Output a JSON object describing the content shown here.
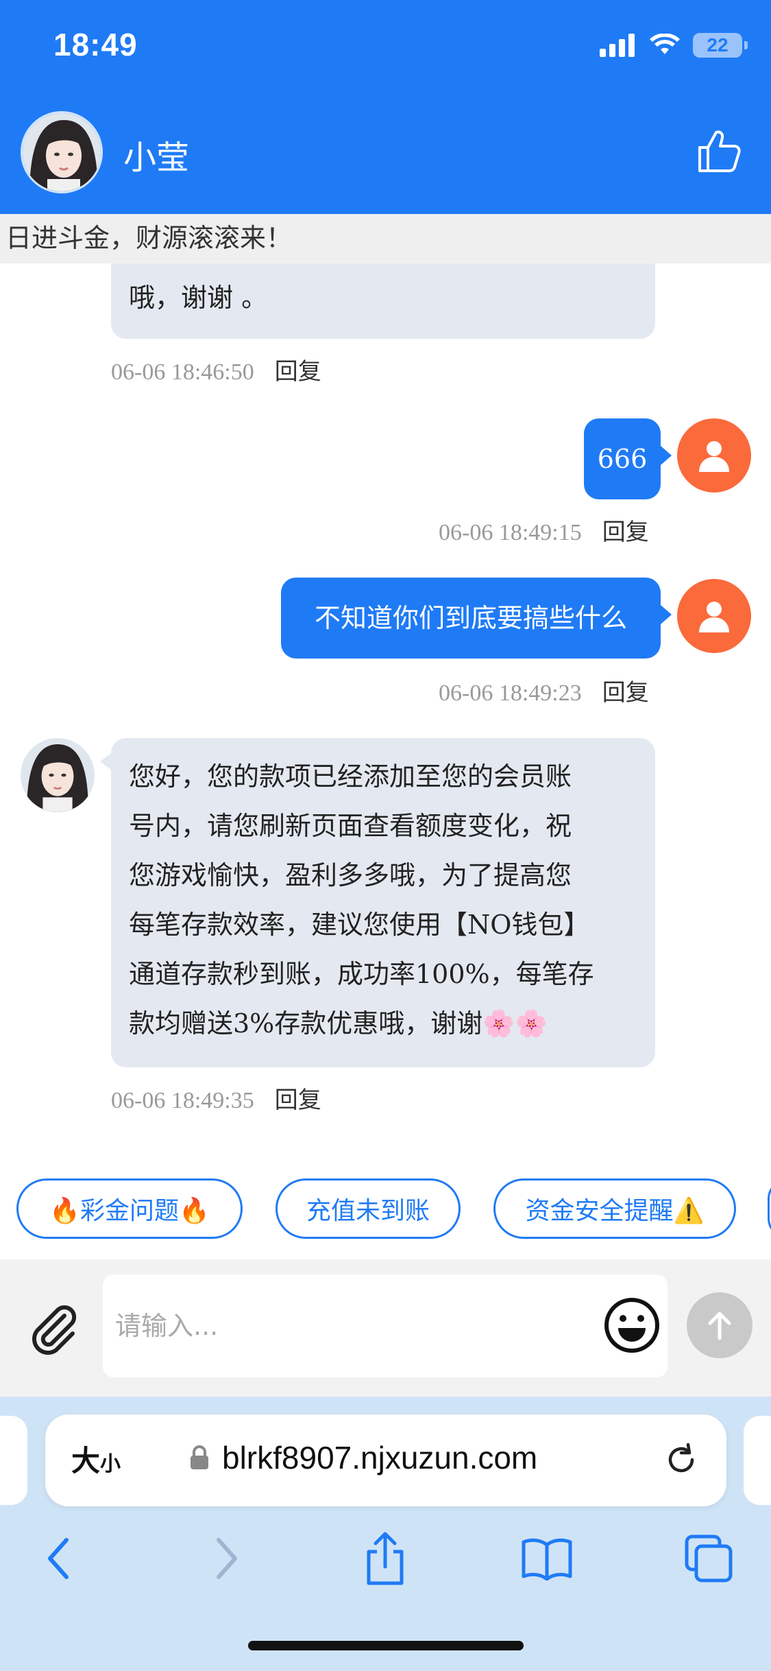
{
  "status_bar": {
    "time": "18:49",
    "battery": "22"
  },
  "header": {
    "agent_name": "小莹"
  },
  "marquee": "日进斗金，财源滚滚来！",
  "messages": [
    {
      "side": "in",
      "text": "哦，谢谢 。",
      "time": "06-06 18:46:50",
      "reply": "回复"
    },
    {
      "side": "out",
      "text": "666",
      "time": "06-06 18:49:15",
      "reply": "回复"
    },
    {
      "side": "out",
      "text": "不知道你们到底要搞些什么",
      "time": "06-06 18:49:23",
      "reply": "回复"
    },
    {
      "side": "in",
      "lines": [
        "您好，您的款项已经添加至您的会员账",
        "号内，请您刷新页面查看额度变化，祝",
        "您游戏愉快，盈利多多哦，为了提高您",
        "每笔存款效率，建议您使用【NO钱包】",
        "通道存款秒到账，成功率100%，每笔存",
        "款均赠送3%存款优惠哦，谢谢🌸🌸"
      ],
      "time": "06-06 18:49:35",
      "reply": "回复"
    }
  ],
  "quick_replies": [
    "🔥彩金问题🔥",
    "充值未到账",
    "资金安全提醒⚠️"
  ],
  "input": {
    "placeholder": "请输入..."
  },
  "browser": {
    "text_size_big": "大",
    "text_size_small": "小",
    "url": "blrkf8907.njxuzun.com"
  },
  "colors": {
    "primary": "#1f7bf5",
    "user_avatar": "#fb6a3b",
    "incoming_bubble": "#e4e9f1"
  }
}
